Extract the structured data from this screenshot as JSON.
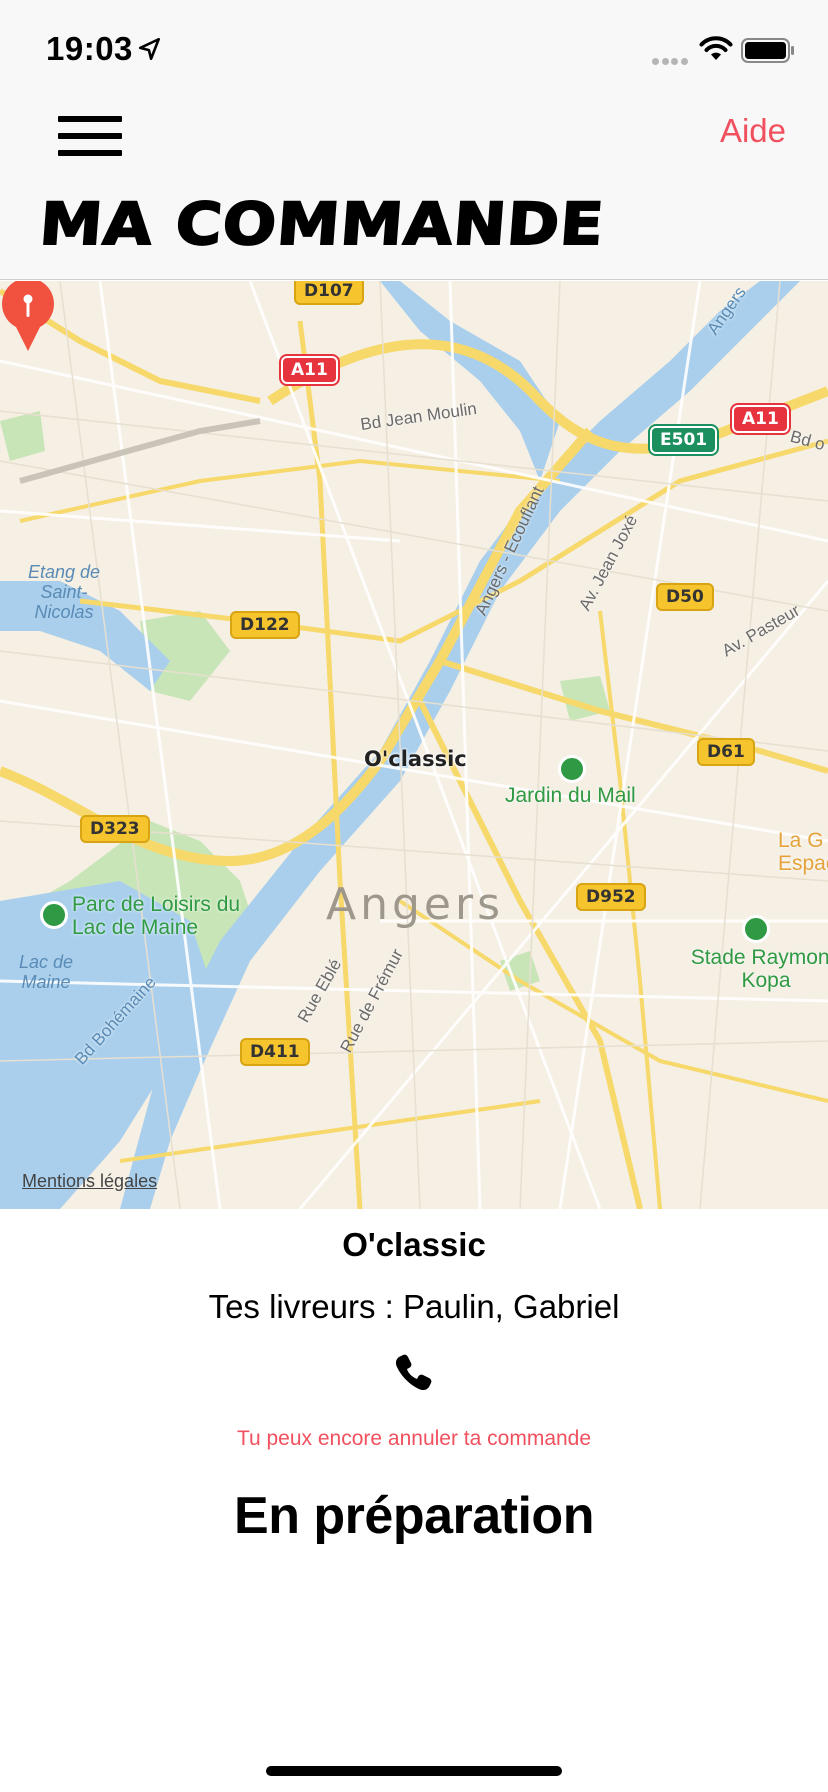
{
  "status_bar": {
    "time": "19:03",
    "icons": [
      "location-arrow-icon",
      "signal-dots-icon",
      "wifi-icon",
      "battery-icon"
    ]
  },
  "header": {
    "menu_icon": "hamburger-menu-icon",
    "help_label": "Aide",
    "title": "MA COMMANDE",
    "accent_color": "#f1505e"
  },
  "map": {
    "pin_label": "O'classic",
    "city_label": "Angers",
    "legal_label": "Mentions légales",
    "road_shields": {
      "d107": "D107",
      "a11_left": "A11",
      "a11_right": "A11",
      "e501": "E501",
      "d122": "D122",
      "d50": "D50",
      "d61": "D61",
      "d323": "D323",
      "d952": "D952",
      "d411": "D411"
    },
    "streets": {
      "bd_jean_moulin": "Bd Jean Moulin",
      "angers_ecouflant": "Angers - Ecouflant",
      "av_jean_joxe": "Av. Jean Joxé",
      "av_pasteur": "Av. Pasteur",
      "bd_o": "Bd o",
      "angers_top": "Angers",
      "rue_eble": "Rue Eblé",
      "rue_fremur": "Rue de Frémur",
      "bd_bohemaine": "Bd Bohémaine"
    },
    "water_labels": {
      "etang": "Etang de Saint-Nicolas",
      "lac": "Lac de Maine"
    },
    "pois": {
      "jardin": "Jardin du Mail",
      "parc": "Parc de Loisirs du Lac de Maine",
      "stade": "Stade Raymond Kopa",
      "la_g": "La G Espac"
    }
  },
  "order": {
    "shop_name": "O'classic",
    "couriers": "Tes livreurs : Paulin, Gabriel",
    "phone_icon": "phone-icon",
    "cancel_text": "Tu peux encore annuler ta commande",
    "status": "En préparation"
  }
}
